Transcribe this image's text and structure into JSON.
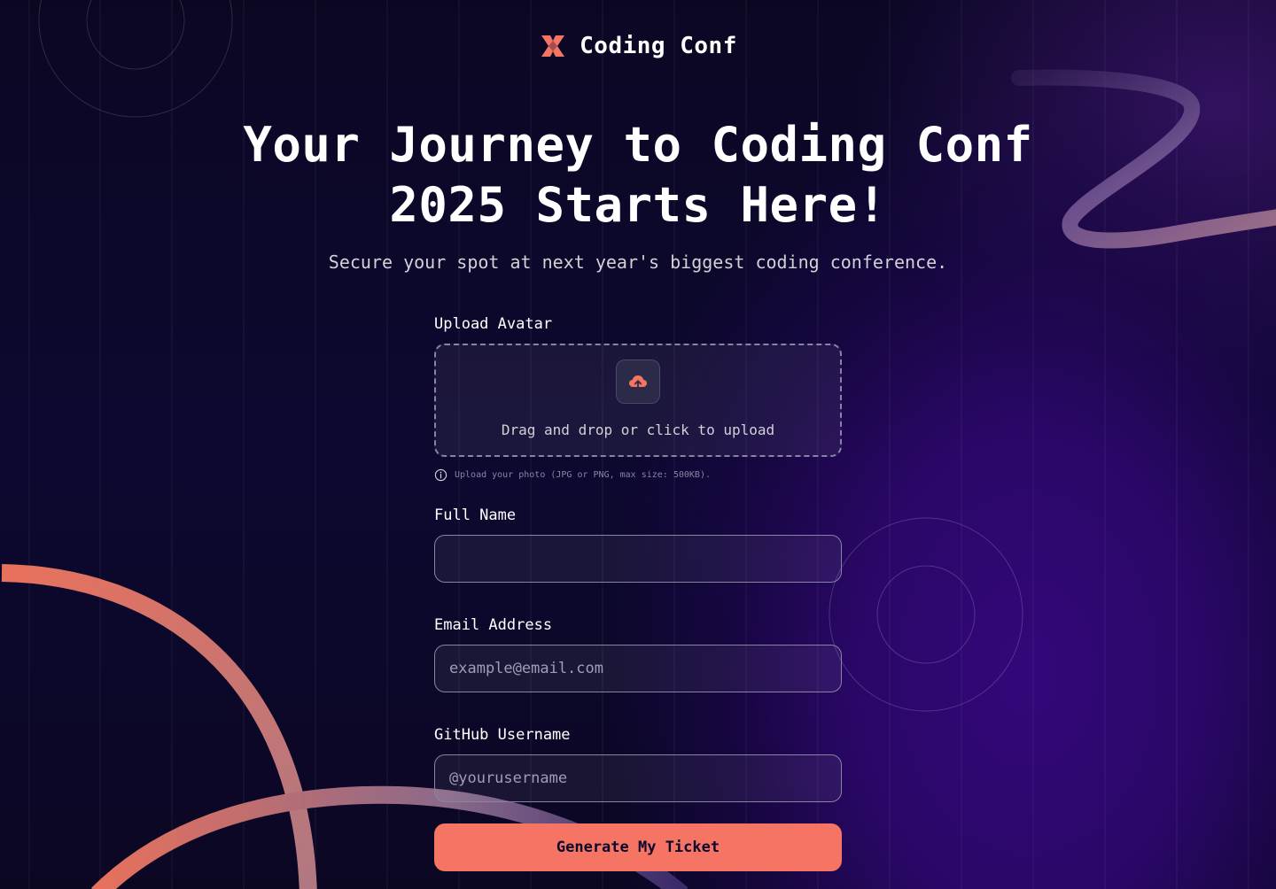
{
  "brand": {
    "name": "Coding Conf",
    "logo_icon": "coding-conf-logo-icon"
  },
  "hero": {
    "title_line1": "Your Journey to Coding Conf",
    "title_line2": "2025 Starts Here!",
    "subtitle": "Secure your spot at next year's biggest coding conference."
  },
  "form": {
    "avatar": {
      "label": "Upload Avatar",
      "dropzone_text": "Drag and drop or click to upload",
      "icon": "cloud-upload-icon",
      "hint": "Upload your photo (JPG or PNG, max size: 500KB).",
      "hint_icon": "info-icon"
    },
    "full_name": {
      "label": "Full Name",
      "value": "",
      "placeholder": ""
    },
    "email": {
      "label": "Email Address",
      "value": "",
      "placeholder": "example@email.com"
    },
    "github": {
      "label": "GitHub Username",
      "value": "",
      "placeholder": "@yourusername"
    },
    "submit_label": "Generate My Ticket"
  },
  "colors": {
    "accent": "#f57463",
    "background": "#0b0723",
    "text_muted": "#d2d1d6",
    "border": "#8784a4"
  }
}
